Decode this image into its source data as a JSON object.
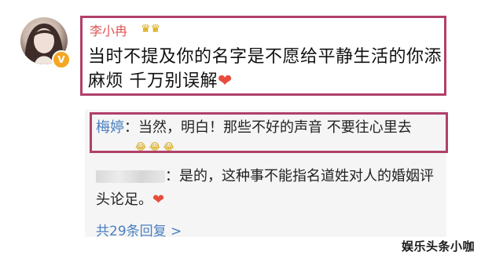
{
  "post": {
    "username": "李小冉",
    "badge_icon": "crown-icon",
    "text": "当时不提及你的名字是不愿给平静生活的你添麻烦 千万别误解",
    "heart": "❤"
  },
  "replies": [
    {
      "author": "梅婷",
      "separator": "：",
      "text": "当然，明白！那些不好的声音 不要往心里去",
      "emoji": "😂 😂 😂"
    },
    {
      "author_hidden": true,
      "separator": "：",
      "text": "是的，这种事不能指名道姓对人的婚姻评头论足。",
      "heart": "❤"
    }
  ],
  "more_replies_label": "共29条回复 >",
  "watermark": "娱乐头条小咖",
  "colors": {
    "highlight_border": "#b0406a",
    "username": "#e05555",
    "link_blue": "#4a7fc1",
    "heart": "#e74c3c"
  }
}
